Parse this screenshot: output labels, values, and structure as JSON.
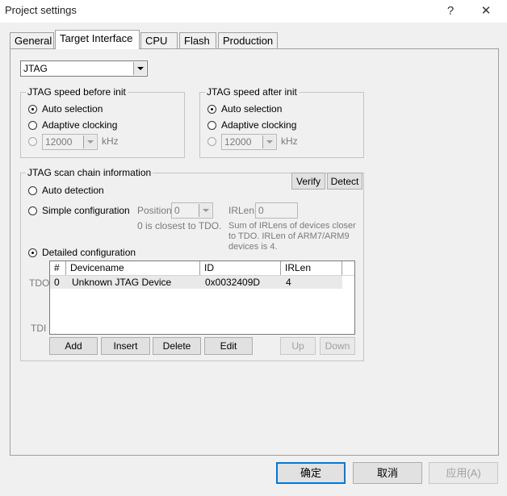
{
  "window": {
    "title": "Project settings",
    "help_glyph": "?",
    "close_glyph": "✕"
  },
  "tabs": [
    "General",
    "Target Interface",
    "CPU",
    "Flash",
    "Production"
  ],
  "interface_select": {
    "value": "JTAG"
  },
  "speed_before": {
    "legend": "JTAG speed before init",
    "options": [
      "Auto selection",
      "Adaptive clocking"
    ],
    "speed_value": "12000",
    "unit": "kHz"
  },
  "speed_after": {
    "legend": "JTAG speed after init",
    "options": [
      "Auto selection",
      "Adaptive clocking"
    ],
    "speed_value": "12000",
    "unit": "kHz"
  },
  "scan_chain": {
    "legend": "JTAG scan chain information",
    "verify": "Verify",
    "detect": "Detect",
    "auto_detection": "Auto detection",
    "simple_configuration": "Simple configuration",
    "position_label": "Position",
    "position_value": "0",
    "position_note": "0 is closest to TDO.",
    "irlen_label": "IRLen",
    "irlen_value": "0",
    "irlen_note": [
      "Sum of IRLens of devices closer",
      "to TDO. IRLen of ARM7/ARM9",
      "devices is 4."
    ],
    "detailed_configuration": "Detailed configuration",
    "tdo": "TDO",
    "tdi": "TDI",
    "columns": [
      "#",
      "Devicename",
      "ID",
      "IRLen"
    ],
    "rows": [
      {
        "index": "0",
        "devicename": "Unknown JTAG Device",
        "id": "0x0032409D",
        "irlen": "4"
      }
    ],
    "buttons": {
      "add": "Add",
      "insert": "Insert",
      "delete": "Delete",
      "edit": "Edit",
      "up": "Up",
      "down": "Down"
    }
  },
  "footer": {
    "ok": "确定",
    "cancel": "取消",
    "apply": "应用(A)"
  }
}
